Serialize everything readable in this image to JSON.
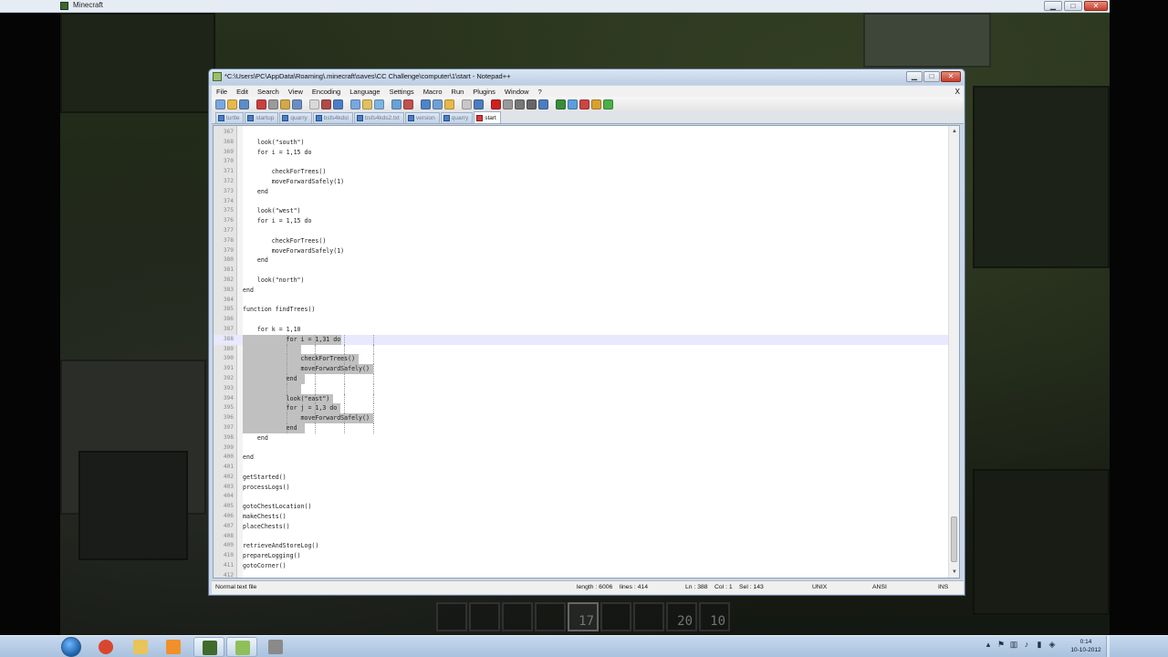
{
  "outer_window": {
    "title": "Minecraft"
  },
  "npp": {
    "title": "*C:\\Users\\PC\\AppData\\Roaming\\.minecraft\\saves\\CC Challenge\\computer\\1\\start - Notepad++",
    "close_doc": "X",
    "menus": [
      "File",
      "Edit",
      "Search",
      "View",
      "Encoding",
      "Language",
      "Settings",
      "Macro",
      "Run",
      "Plugins",
      "Window",
      "?"
    ],
    "toolbar_colors": [
      "#7aa7e0",
      "#e8b84a",
      "#5f8cc8",
      "#c94040",
      "#9a9a9a",
      "#d3a848",
      "#6b8ec2",
      "#d9d9d9",
      "#b04a4a",
      "#4a7fc7",
      "#7aa7e0",
      "#e0c060",
      "#7db5e0",
      "#6aa0d8",
      "#c35050",
      "#4f84c8",
      "#6f9fd4",
      "#e8b84a",
      "#c7c7c7",
      "#4d7cc0",
      "#c22",
      "#999",
      "#777",
      "#666",
      "#4d7cc0",
      "#3a8c3a",
      "#5a9fdc",
      "#c44",
      "#d9a030",
      "#4ab04a"
    ],
    "tabs": [
      {
        "label": "turtle",
        "active": false
      },
      {
        "label": "startup",
        "active": false
      },
      {
        "label": "quarry",
        "active": false
      },
      {
        "label": "bsfs4kdsl",
        "active": false
      },
      {
        "label": "bsfs4kds2.txt",
        "active": false
      },
      {
        "label": "version",
        "active": false
      },
      {
        "label": "quarry",
        "active": false
      },
      {
        "label": "start",
        "active": true
      }
    ],
    "lines": [
      {
        "n": "367",
        "t": ""
      },
      {
        "n": "368",
        "t": "    look(\"south\")"
      },
      {
        "n": "369",
        "t": "    for i = 1,15 do"
      },
      {
        "n": "370",
        "t": ""
      },
      {
        "n": "371",
        "t": "        checkForTrees()"
      },
      {
        "n": "372",
        "t": "        moveForwardSafely(1)"
      },
      {
        "n": "373",
        "t": "    end"
      },
      {
        "n": "374",
        "t": ""
      },
      {
        "n": "375",
        "t": "    look(\"west\")"
      },
      {
        "n": "376",
        "t": "    for i = 1,15 do"
      },
      {
        "n": "377",
        "t": ""
      },
      {
        "n": "378",
        "t": "        checkForTrees()"
      },
      {
        "n": "379",
        "t": "        moveForwardSafely(1)"
      },
      {
        "n": "380",
        "t": "    end"
      },
      {
        "n": "381",
        "t": ""
      },
      {
        "n": "382",
        "t": "    look(\"north\")"
      },
      {
        "n": "383",
        "t": "end"
      },
      {
        "n": "384",
        "t": ""
      },
      {
        "n": "385",
        "t": "function findTrees()"
      },
      {
        "n": "386",
        "t": ""
      },
      {
        "n": "387",
        "t": "    for k = 1,10"
      },
      {
        "n": "388",
        "t": "            for i = 1,31 do"
      },
      {
        "n": "389",
        "t": ""
      },
      {
        "n": "390",
        "t": "                checkForTrees()"
      },
      {
        "n": "391",
        "t": "                moveForwardSafely()"
      },
      {
        "n": "392",
        "t": "            end"
      },
      {
        "n": "393",
        "t": ""
      },
      {
        "n": "394",
        "t": "            look(\"east\")"
      },
      {
        "n": "395",
        "t": "            for j = 1,3 do"
      },
      {
        "n": "396",
        "t": "                moveForwardSafely()"
      },
      {
        "n": "397",
        "t": "            end"
      },
      {
        "n": "398",
        "t": "    end"
      },
      {
        "n": "399",
        "t": ""
      },
      {
        "n": "400",
        "t": "end"
      },
      {
        "n": "401",
        "t": ""
      },
      {
        "n": "402",
        "t": "getStarted()"
      },
      {
        "n": "403",
        "t": "processLogs()"
      },
      {
        "n": "404",
        "t": ""
      },
      {
        "n": "405",
        "t": "gotoChestLocation()"
      },
      {
        "n": "406",
        "t": "makeChests()"
      },
      {
        "n": "407",
        "t": "placeChests()"
      },
      {
        "n": "408",
        "t": ""
      },
      {
        "n": "409",
        "t": "retrieveAndStoreLog()"
      },
      {
        "n": "410",
        "t": "prepareLogging()"
      },
      {
        "n": "411",
        "t": "gotoCorner()"
      },
      {
        "n": "412",
        "t": ""
      }
    ],
    "status": {
      "filetype": "Normal text file",
      "length": "length : 6006",
      "lines": "lines : 414",
      "ln": "Ln : 388",
      "col": "Col : 1",
      "sel": "Sel : 143",
      "eol": "UNIX",
      "encoding": "ANSI",
      "mode": "INS"
    }
  },
  "hotbar": [
    {
      "count": ""
    },
    {
      "count": ""
    },
    {
      "count": ""
    },
    {
      "count": ""
    },
    {
      "count": "17",
      "selected": true
    },
    {
      "count": ""
    },
    {
      "count": ""
    },
    {
      "count": "20"
    },
    {
      "count": "10"
    }
  ],
  "taskbar": {
    "apps": [
      {
        "name": "chrome",
        "color": "#d9462f",
        "active": false
      },
      {
        "name": "explorer",
        "color": "#e8c45a",
        "active": false
      },
      {
        "name": "media-player",
        "color": "#f0902a",
        "active": false
      },
      {
        "name": "minecraft",
        "color": "#3f6b2b",
        "active": true
      },
      {
        "name": "notepad-plus-plus",
        "color": "#8fbf5a",
        "active": true
      },
      {
        "name": "app-grid",
        "color": "#8a8a8a",
        "active": false
      }
    ],
    "clock_time": "0:14",
    "clock_date": "10-10-2012"
  }
}
